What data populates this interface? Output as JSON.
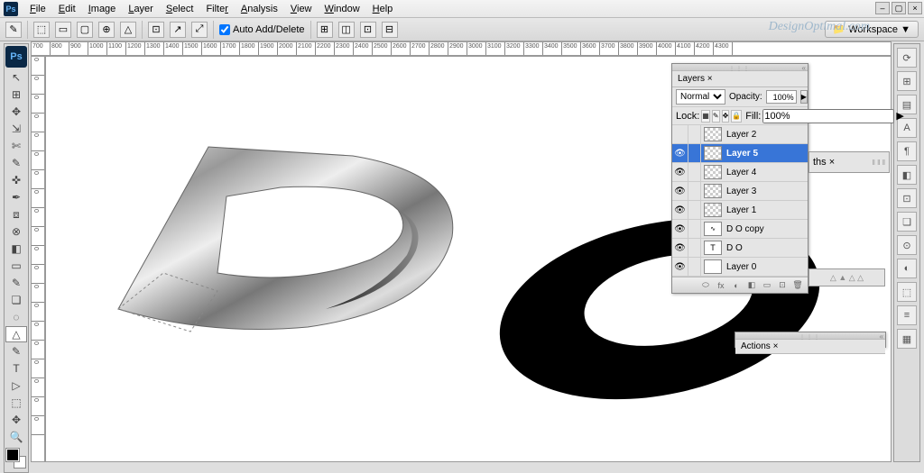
{
  "menu": {
    "items": [
      "File",
      "Edit",
      "Image",
      "Layer",
      "Select",
      "Filter",
      "Analysis",
      "View",
      "Window",
      "Help"
    ],
    "ps": "Ps"
  },
  "options": {
    "checkbox": "Auto Add/Delete",
    "workspace": "Workspace ▼"
  },
  "watermark": "DesignOptimal.com",
  "ruler_h": [
    "700",
    "800",
    "900",
    "1000",
    "1100",
    "1200",
    "1300",
    "1400",
    "1500",
    "1600",
    "1700",
    "1800",
    "1900",
    "2000",
    "2100",
    "2200",
    "2300",
    "2400",
    "2500",
    "2600",
    "2700",
    "2800",
    "2900",
    "3000",
    "3100",
    "3200",
    "3300",
    "3400",
    "3500",
    "3600",
    "3700",
    "3800",
    "3900",
    "4000",
    "4100",
    "4200",
    "4300"
  ],
  "ruler_v": [
    "0",
    "0",
    "0",
    "0",
    "0",
    "0",
    "0",
    "0",
    "0",
    "0",
    "0",
    "0",
    "0",
    "0",
    "0",
    "0",
    "0",
    "0",
    "0",
    "0"
  ],
  "tools": [
    "↖",
    "⊞",
    "✥",
    "⇲",
    "✄",
    "✎",
    "✜",
    "✒",
    "⧈",
    "⊗",
    "◧",
    "▭",
    "✎",
    "❏",
    "◌",
    "△",
    "✎",
    "T",
    "▷",
    "⬚",
    "✥",
    "🔍"
  ],
  "rpanel": [
    "⟳",
    "⊞",
    "▤",
    "A",
    "¶",
    "◧",
    "⊡",
    "❏",
    "⊙",
    "◐",
    "⬚",
    "≡",
    "▦"
  ],
  "layers": {
    "title": "Layers ×",
    "blend": "Normal",
    "opacity_label": "Opacity:",
    "opacity": "100%",
    "lock_label": "Lock:",
    "fill_label": "Fill:",
    "fill": "100%",
    "items": [
      {
        "name": "Layer 2",
        "visible": false,
        "thumb": "checker"
      },
      {
        "name": "Layer 5",
        "visible": true,
        "thumb": "checker",
        "selected": true
      },
      {
        "name": "Layer 4",
        "visible": true,
        "thumb": "checker"
      },
      {
        "name": "Layer 3",
        "visible": true,
        "thumb": "checker"
      },
      {
        "name": "Layer 1",
        "visible": true,
        "thumb": "checker"
      },
      {
        "name": "D O copy",
        "visible": true,
        "thumb": "fx"
      },
      {
        "name": "D O",
        "visible": true,
        "thumb": "T"
      },
      {
        "name": "Layer 0",
        "visible": true,
        "thumb": "white"
      }
    ],
    "footer_icons": [
      "⬭",
      "fx",
      "◐",
      "◧",
      "▭",
      "⊡",
      "🗑"
    ]
  },
  "paths": {
    "title": "ths ×"
  },
  "actions": {
    "title": "Actions ×"
  }
}
